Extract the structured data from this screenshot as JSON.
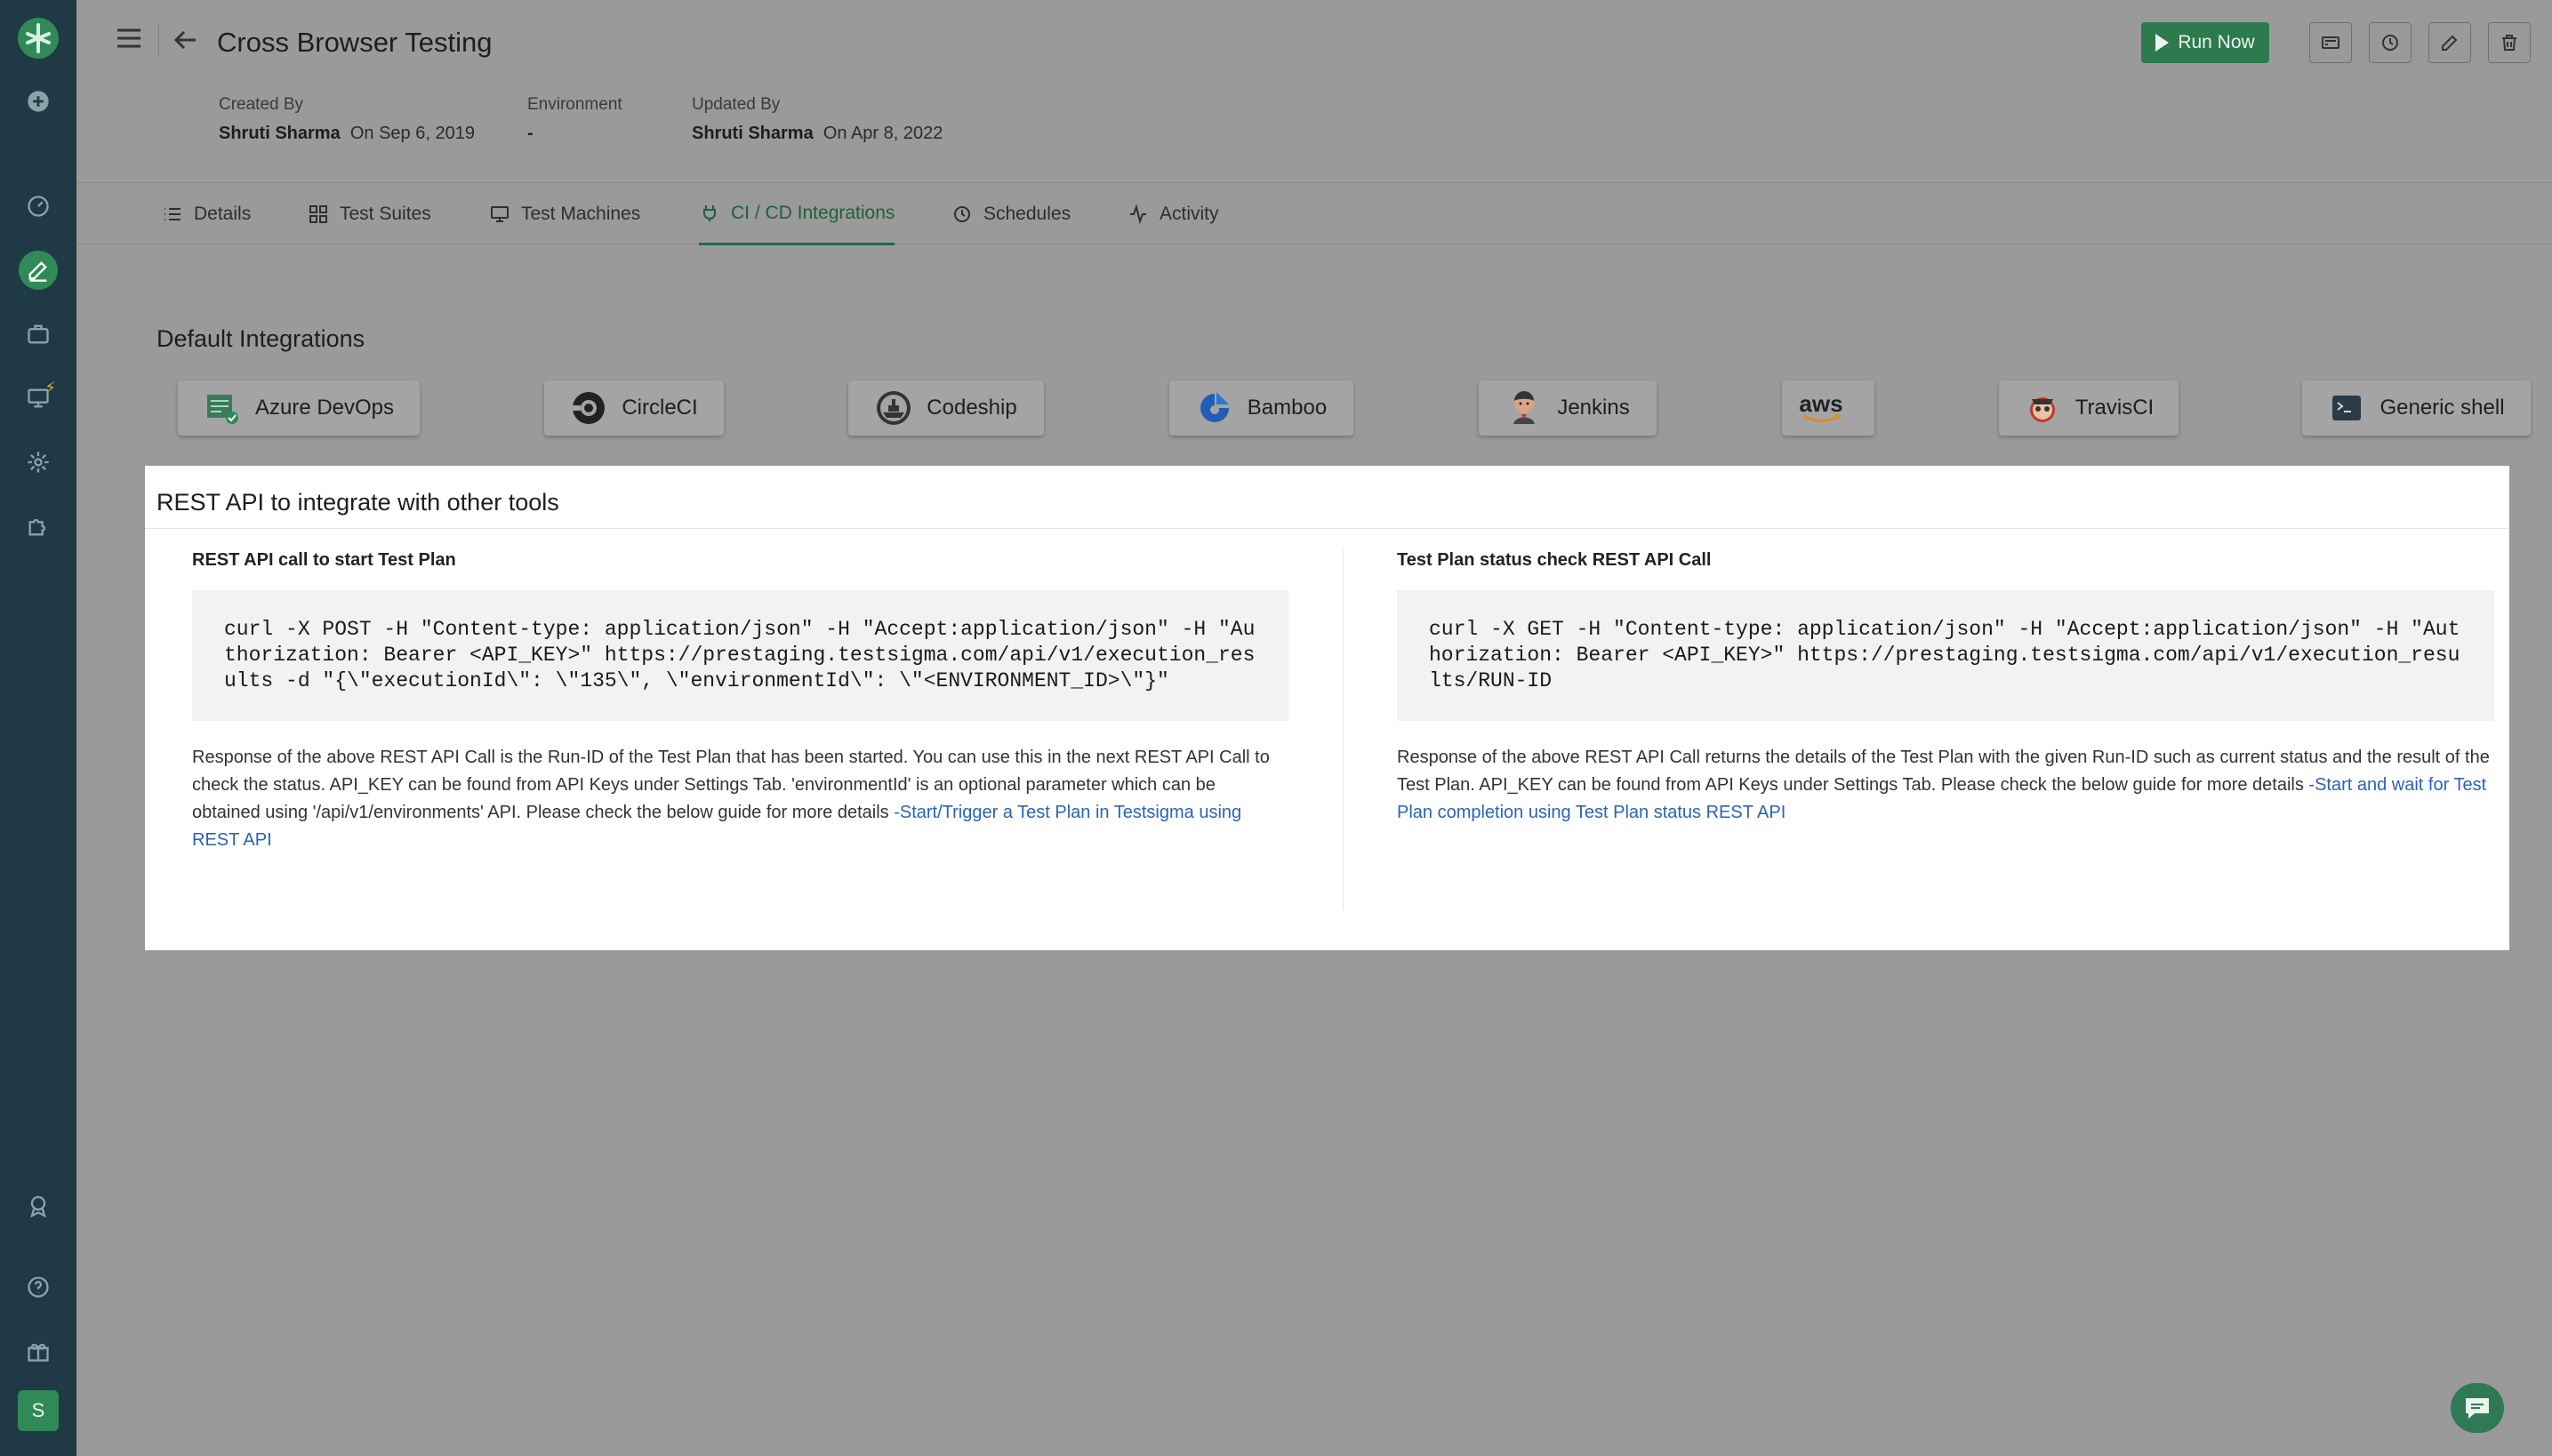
{
  "app": {
    "title": "Cross Browser Testing",
    "avatar_letter": "S"
  },
  "header": {
    "run_now_label": "Run Now",
    "meta": [
      {
        "label": "Created By",
        "name": "Shruti Sharma",
        "date": "On Sep 6, 2019"
      },
      {
        "label": "Environment",
        "name": "-",
        "date": ""
      },
      {
        "label": "Updated By",
        "name": "Shruti Sharma",
        "date": "On Apr 8, 2022"
      }
    ]
  },
  "tabs": [
    {
      "label": "Details",
      "icon": "list-icon"
    },
    {
      "label": "Test Suites",
      "icon": "suite-icon"
    },
    {
      "label": "Test Machines",
      "icon": "monitor-icon"
    },
    {
      "label": "CI / CD Integrations",
      "icon": "plug-icon",
      "active": true
    },
    {
      "label": "Schedules",
      "icon": "clock-icon"
    },
    {
      "label": "Activity",
      "icon": "activity-icon"
    }
  ],
  "integrations": {
    "title": "Default Integrations",
    "items": [
      {
        "label": "Azure DevOps",
        "icon": "azure-devops-icon"
      },
      {
        "label": "CircleCI",
        "icon": "circleci-icon"
      },
      {
        "label": "Codeship",
        "icon": "codeship-icon"
      },
      {
        "label": "Bamboo",
        "icon": "bamboo-icon"
      },
      {
        "label": "Jenkins",
        "icon": "jenkins-icon"
      },
      {
        "label": "",
        "icon": "aws-icon",
        "logo_text": "aws"
      },
      {
        "label": "TravisCI",
        "icon": "travisci-icon"
      },
      {
        "label": "Generic shell",
        "icon": "shell-icon"
      }
    ]
  },
  "rest": {
    "title": "REST API to integrate with other tools",
    "start": {
      "title": "REST API call to start Test Plan",
      "code": "curl -X POST -H \"Content-type: application/json\" -H \"Accept:application/json\" -H \"Authorization: Bearer <API_KEY>\" https://prestaging.testsigma.com/api/v1/execution_results -d \"{\\\"executionId\\\": \\\"135\\\", \\\"environmentId\\\": \\\"<ENVIRONMENT_ID>\\\"}\"",
      "desc": "Response of the above REST API Call is the Run-ID of the Test Plan that has been started. You can use this in the next REST API Call to check the status. API_KEY can be found from API Keys under Settings Tab. 'environmentId' is an optional parameter which can be obtained using '/api/v1/environments' API. Please check the below guide for more details ",
      "link": "-Start/Trigger a Test Plan in Testsigma using REST API"
    },
    "status": {
      "title": "Test Plan status check REST API Call",
      "code": "curl -X GET -H \"Content-type: application/json\" -H \"Accept:application/json\" -H \"Authorization: Bearer <API_KEY>\" https://prestaging.testsigma.com/api/v1/execution_results/RUN-ID",
      "desc": "Response of the above REST API Call returns the details of the Test Plan with the given Run-ID such as current status and the result of the Test Plan. API_KEY can be found from API Keys under Settings Tab. Please check the below guide for more details ",
      "link": "-Start and wait for Test Plan completion using Test Plan status REST API"
    }
  },
  "colors": {
    "nav_bg": "#1f3a44",
    "accent_green": "#2c7a4e",
    "link_blue": "#2a63b8"
  }
}
